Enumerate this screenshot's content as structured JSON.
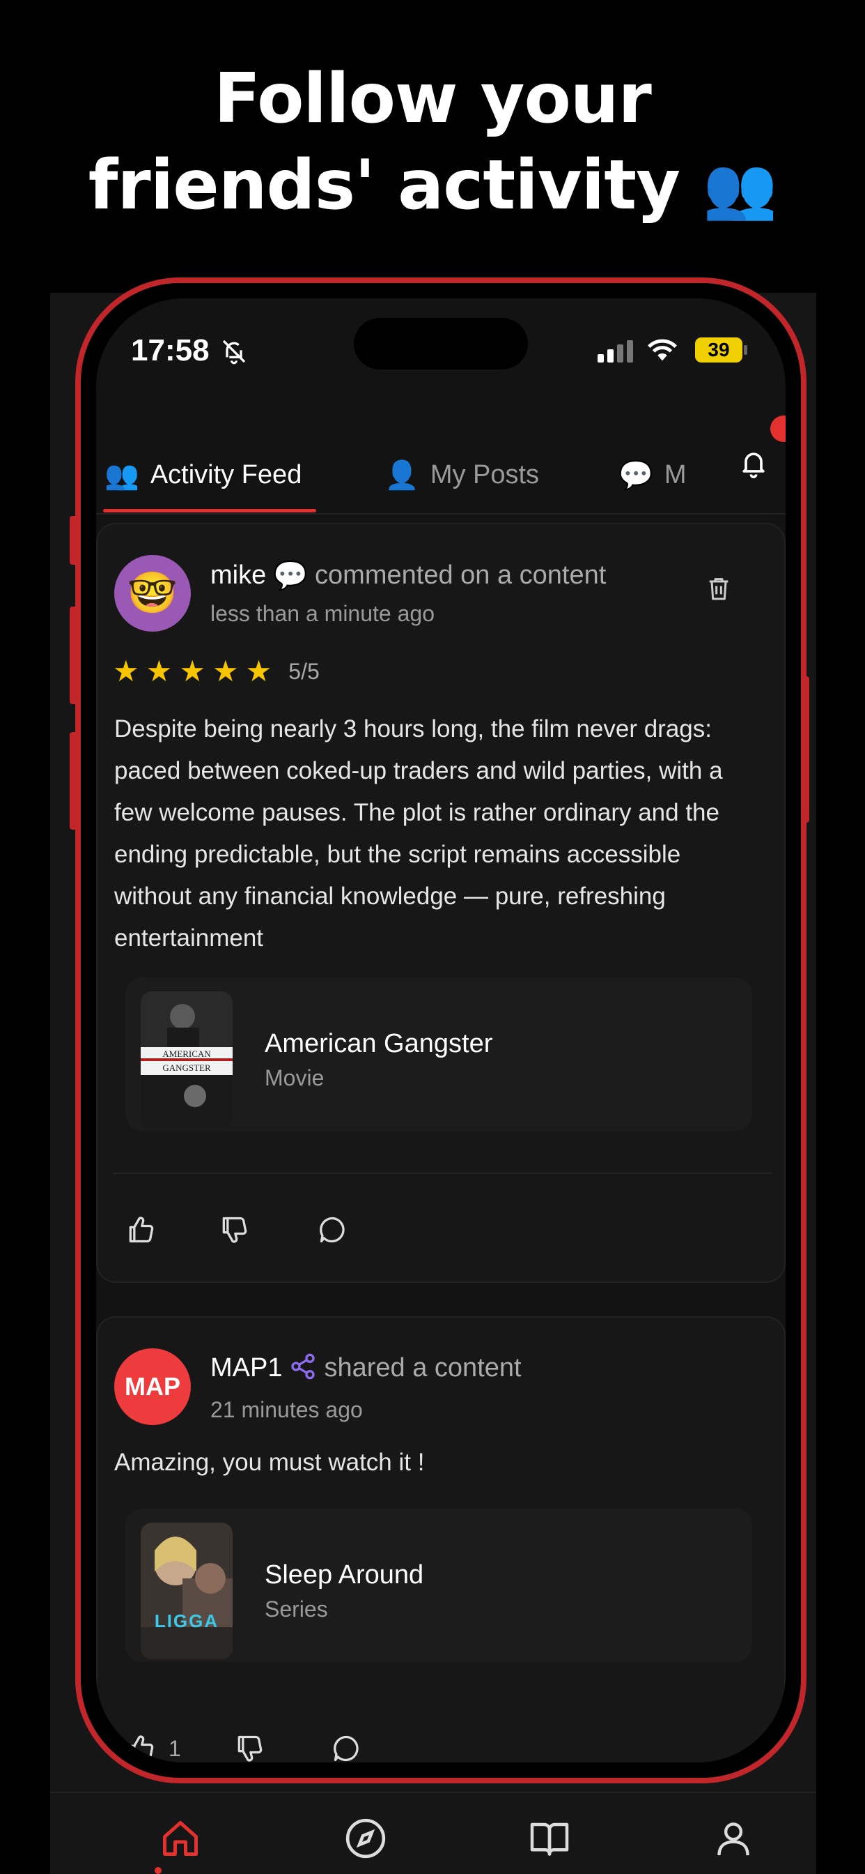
{
  "headline": {
    "line1": "Follow your",
    "line2": "friends' activity",
    "emoji": "👥"
  },
  "status_bar": {
    "time": "17:58",
    "battery": "39"
  },
  "tabs": [
    {
      "icon": "👥",
      "label": "Activity Feed",
      "active": true
    },
    {
      "icon": "👤",
      "label": "My Posts",
      "active": false
    },
    {
      "icon": "💬",
      "label": "M",
      "active": false
    }
  ],
  "posts": [
    {
      "avatar_emoji": "🤓",
      "username": "mike",
      "action_icon": "💬",
      "action": "commented on a content",
      "time": "less than a minute ago",
      "rating_text": "5/5",
      "rating": 5,
      "review": "Despite being nearly 3 hours long, the film never drags: paced between coked-up traders and wild parties, with a few welcome pauses. The plot is rather ordinary and the ending predictable, but the script remains accessible without any financial knowledge — pure, refreshing entertainment",
      "content": {
        "title": "American Gangster",
        "type": "Movie",
        "poster_text": "AMERICAN GANGSTER"
      }
    },
    {
      "avatar_text": "MAP",
      "username": "MAP1",
      "action_icon": "share-icon",
      "action": "shared a content",
      "time": "21 minutes ago",
      "review": "Amazing, you must watch it !",
      "content": {
        "title": "Sleep Around",
        "type": "Series",
        "poster_text": "LIGGA"
      },
      "like_count": "1"
    }
  ],
  "colors": {
    "accent": "#e2312f",
    "frame": "#c0262a",
    "star": "#f7c400",
    "share": "#8e6cf0"
  },
  "bottom_nav": [
    "home-icon",
    "compass-icon",
    "book-icon",
    "profile-icon"
  ]
}
